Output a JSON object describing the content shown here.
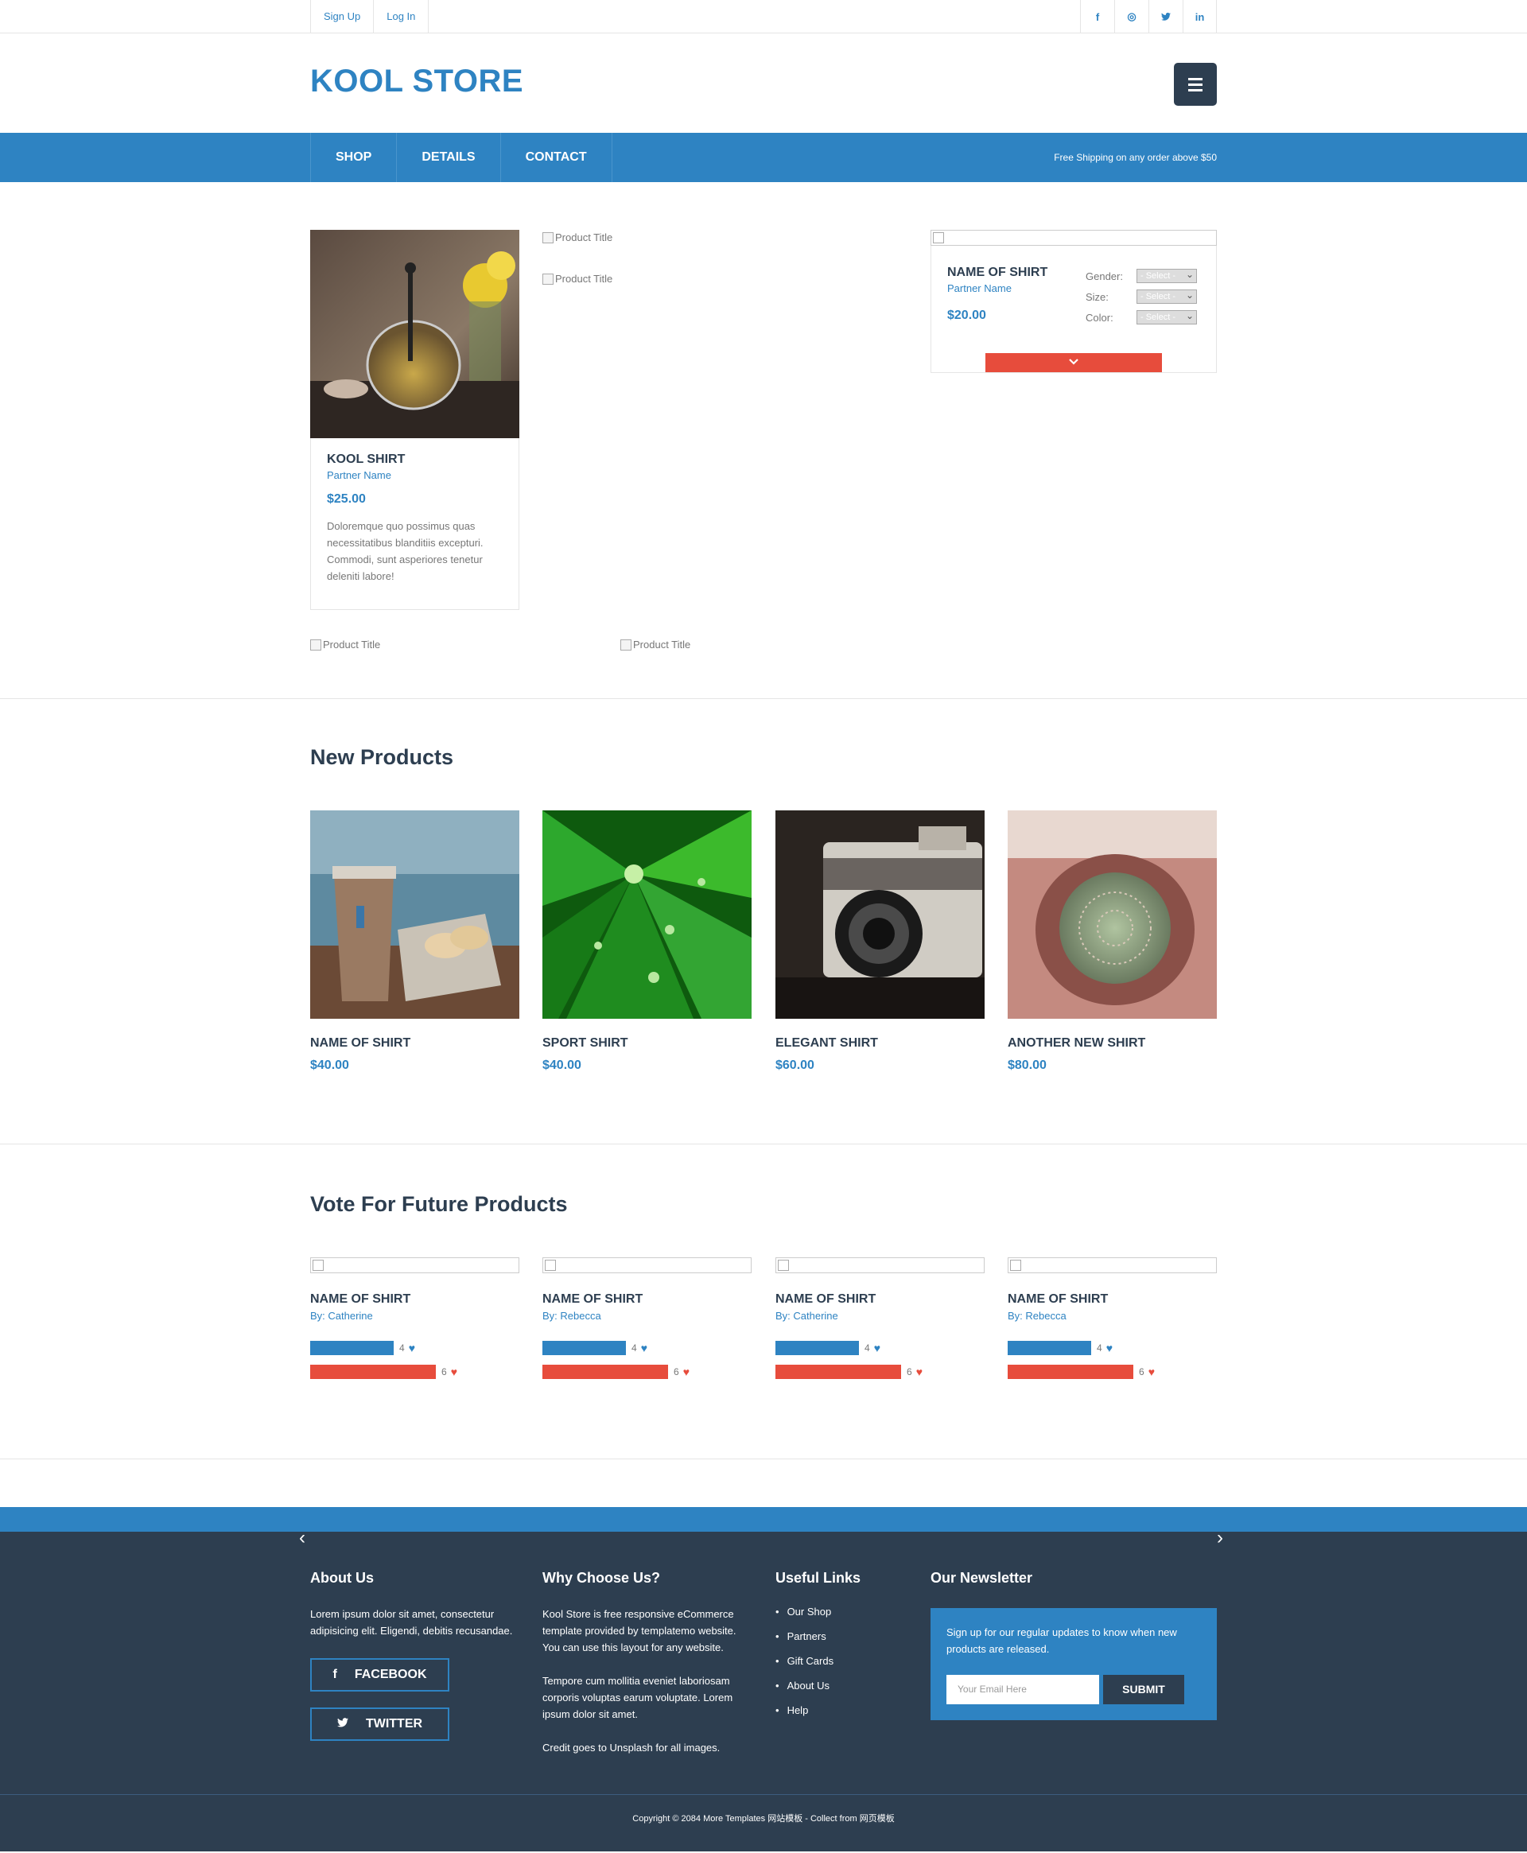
{
  "topbar": {
    "links": [
      "Sign Up",
      "Log In"
    ],
    "social": [
      "f",
      "◎",
      "t",
      "in"
    ]
  },
  "header": {
    "logo": "KOOL STORE"
  },
  "nav": {
    "items": [
      "SHOP",
      "DETAILS",
      "CONTACT"
    ],
    "shipping": "Free Shipping on any order above $50"
  },
  "featured": {
    "card": {
      "name": "KOOL SHIRT",
      "partner": "Partner Name",
      "price": "$25.00",
      "desc": "Doloremque quo possimus quas necessitatibus blanditiis excepturi. Commodi, sunt asperiores tenetur deleniti labore!"
    },
    "broken_alt": "Product Title",
    "detail": {
      "name": "NAME OF SHIRT",
      "partner": "Partner Name",
      "price": "$20.00",
      "gender_label": "Gender:",
      "size_label": "Size:",
      "color_label": "Color:",
      "select_placeholder": "- Select -"
    }
  },
  "new_products": {
    "title": "New Products",
    "items": [
      {
        "name": "NAME OF SHIRT",
        "price": "$40.00"
      },
      {
        "name": "SPORT SHIRT",
        "price": "$40.00"
      },
      {
        "name": "ELEGANT SHIRT",
        "price": "$60.00"
      },
      {
        "name": "ANOTHER NEW SHIRT",
        "price": "$80.00"
      }
    ]
  },
  "vote": {
    "title": "Vote For Future Products",
    "items": [
      {
        "name": "NAME OF SHIRT",
        "by": "By: Catherine",
        "blue": "4",
        "red": "6"
      },
      {
        "name": "NAME OF SHIRT",
        "by": "By: Rebecca",
        "blue": "4",
        "red": "6"
      },
      {
        "name": "NAME OF SHIRT",
        "by": "By: Catherine",
        "blue": "4",
        "red": "6"
      },
      {
        "name": "NAME OF SHIRT",
        "by": "By: Rebecca",
        "blue": "4",
        "red": "6"
      }
    ]
  },
  "footer": {
    "about": {
      "title": "About Us",
      "text": "Lorem ipsum dolor sit amet, consectetur adipisicing elit. Eligendi, debitis recusandae.",
      "facebook": "FACEBOOK",
      "twitter": "TWITTER"
    },
    "why": {
      "title": "Why Choose Us?",
      "p1": "Kool Store is free responsive eCommerce template provided by templatemo website. You can use this layout for any website.",
      "p2": "Tempore cum mollitia eveniet laboriosam corporis voluptas earum voluptate. Lorem ipsum dolor sit amet.",
      "p3": "Credit goes to Unsplash for all images."
    },
    "links": {
      "title": "Useful Links",
      "items": [
        "Our Shop",
        "Partners",
        "Gift Cards",
        "About Us",
        "Help"
      ]
    },
    "newsletter": {
      "title": "Our Newsletter",
      "text": "Sign up for our regular updates to know when new products are released.",
      "placeholder": "Your Email Here",
      "submit": "SUBMIT"
    },
    "copyright": "Copyright © 2084 More Templates 网站模板 - Collect from 网页模板"
  },
  "colors": {
    "primary": "#2e83c2",
    "dark": "#2d3e50",
    "red": "#e74c3c"
  }
}
